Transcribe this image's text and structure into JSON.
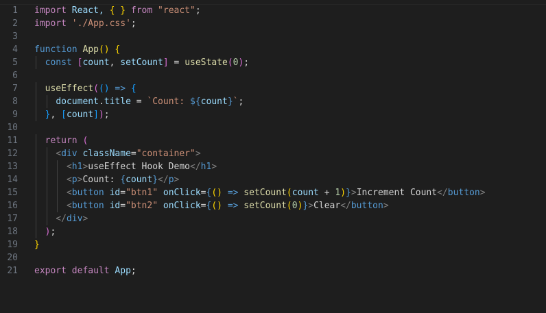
{
  "editor": {
    "line_numbers": [
      "1",
      "2",
      "3",
      "4",
      "5",
      "6",
      "7",
      "8",
      "9",
      "10",
      "11",
      "12",
      "13",
      "14",
      "15",
      "16",
      "17",
      "18",
      "19",
      "20",
      "21"
    ],
    "lines": [
      [
        {
          "t": "import",
          "c": "kw"
        },
        {
          "t": " React, ",
          "c": "var"
        },
        {
          "t": "{ }",
          "c": "br1"
        },
        {
          "t": " ",
          "c": "txt"
        },
        {
          "t": "from",
          "c": "kw"
        },
        {
          "t": " ",
          "c": "txt"
        },
        {
          "t": "\"react\"",
          "c": "str"
        },
        {
          "t": ";",
          "c": "txt"
        }
      ],
      [
        {
          "t": "import",
          "c": "kw"
        },
        {
          "t": " ",
          "c": "txt"
        },
        {
          "t": "'./App.css'",
          "c": "str"
        },
        {
          "t": ";",
          "c": "txt"
        }
      ],
      [],
      [
        {
          "t": "function",
          "c": "kw2"
        },
        {
          "t": " ",
          "c": "txt"
        },
        {
          "t": "App",
          "c": "fn"
        },
        {
          "t": "()",
          "c": "br1"
        },
        {
          "t": " ",
          "c": "txt"
        },
        {
          "t": "{",
          "c": "br1"
        }
      ],
      [
        {
          "t": "  ",
          "c": "txt"
        },
        {
          "t": "const",
          "c": "kw2"
        },
        {
          "t": " ",
          "c": "txt"
        },
        {
          "t": "[",
          "c": "br2"
        },
        {
          "t": "count",
          "c": "var"
        },
        {
          "t": ", ",
          "c": "txt"
        },
        {
          "t": "setCount",
          "c": "var"
        },
        {
          "t": "]",
          "c": "br2"
        },
        {
          "t": " = ",
          "c": "txt"
        },
        {
          "t": "useState",
          "c": "fn"
        },
        {
          "t": "(",
          "c": "br2"
        },
        {
          "t": "0",
          "c": "num"
        },
        {
          "t": ")",
          "c": "br2"
        },
        {
          "t": ";",
          "c": "txt"
        }
      ],
      [],
      [
        {
          "t": "  ",
          "c": "txt"
        },
        {
          "t": "useEffect",
          "c": "fn"
        },
        {
          "t": "(",
          "c": "br2"
        },
        {
          "t": "()",
          "c": "br3"
        },
        {
          "t": " ",
          "c": "txt"
        },
        {
          "t": "=>",
          "c": "kw2"
        },
        {
          "t": " ",
          "c": "txt"
        },
        {
          "t": "{",
          "c": "br3"
        }
      ],
      [
        {
          "t": "    ",
          "c": "txt"
        },
        {
          "t": "document",
          "c": "var"
        },
        {
          "t": ".",
          "c": "txt"
        },
        {
          "t": "title",
          "c": "var"
        },
        {
          "t": " = ",
          "c": "txt"
        },
        {
          "t": "`Count: ",
          "c": "str"
        },
        {
          "t": "${",
          "c": "kw2"
        },
        {
          "t": "count",
          "c": "var"
        },
        {
          "t": "}",
          "c": "kw2"
        },
        {
          "t": "`",
          "c": "str"
        },
        {
          "t": ";",
          "c": "txt"
        }
      ],
      [
        {
          "t": "  ",
          "c": "txt"
        },
        {
          "t": "}",
          "c": "br3"
        },
        {
          "t": ", ",
          "c": "txt"
        },
        {
          "t": "[",
          "c": "br3"
        },
        {
          "t": "count",
          "c": "var"
        },
        {
          "t": "]",
          "c": "br3"
        },
        {
          "t": ")",
          "c": "br2"
        },
        {
          "t": ";",
          "c": "txt"
        }
      ],
      [],
      [
        {
          "t": "  ",
          "c": "txt"
        },
        {
          "t": "return",
          "c": "kw"
        },
        {
          "t": " ",
          "c": "txt"
        },
        {
          "t": "(",
          "c": "br2"
        }
      ],
      [
        {
          "t": "    ",
          "c": "txt"
        },
        {
          "t": "<",
          "c": "pun"
        },
        {
          "t": "div",
          "c": "tag"
        },
        {
          "t": " ",
          "c": "txt"
        },
        {
          "t": "className",
          "c": "attr"
        },
        {
          "t": "=",
          "c": "txt"
        },
        {
          "t": "\"container\"",
          "c": "str"
        },
        {
          "t": ">",
          "c": "pun"
        }
      ],
      [
        {
          "t": "      ",
          "c": "txt"
        },
        {
          "t": "<",
          "c": "pun"
        },
        {
          "t": "h1",
          "c": "tag"
        },
        {
          "t": ">",
          "c": "pun"
        },
        {
          "t": "useEffect Hook Demo",
          "c": "txt"
        },
        {
          "t": "</",
          "c": "pun"
        },
        {
          "t": "h1",
          "c": "tag"
        },
        {
          "t": ">",
          "c": "pun"
        }
      ],
      [
        {
          "t": "      ",
          "c": "txt"
        },
        {
          "t": "<",
          "c": "pun"
        },
        {
          "t": "p",
          "c": "tag"
        },
        {
          "t": ">",
          "c": "pun"
        },
        {
          "t": "Count: ",
          "c": "txt"
        },
        {
          "t": "{",
          "c": "kw2"
        },
        {
          "t": "count",
          "c": "var"
        },
        {
          "t": "}",
          "c": "kw2"
        },
        {
          "t": "</",
          "c": "pun"
        },
        {
          "t": "p",
          "c": "tag"
        },
        {
          "t": ">",
          "c": "pun"
        }
      ],
      [
        {
          "t": "      ",
          "c": "txt"
        },
        {
          "t": "<",
          "c": "pun"
        },
        {
          "t": "button",
          "c": "tag"
        },
        {
          "t": " ",
          "c": "txt"
        },
        {
          "t": "id",
          "c": "attr"
        },
        {
          "t": "=",
          "c": "txt"
        },
        {
          "t": "\"btn1\"",
          "c": "str"
        },
        {
          "t": " ",
          "c": "txt"
        },
        {
          "t": "onClick",
          "c": "attr"
        },
        {
          "t": "=",
          "c": "txt"
        },
        {
          "t": "{",
          "c": "kw2"
        },
        {
          "t": "()",
          "c": "br1"
        },
        {
          "t": " ",
          "c": "txt"
        },
        {
          "t": "=>",
          "c": "kw2"
        },
        {
          "t": " ",
          "c": "txt"
        },
        {
          "t": "setCount",
          "c": "fn"
        },
        {
          "t": "(",
          "c": "br1"
        },
        {
          "t": "count",
          "c": "var"
        },
        {
          "t": " + ",
          "c": "txt"
        },
        {
          "t": "1",
          "c": "num"
        },
        {
          "t": ")",
          "c": "br1"
        },
        {
          "t": "}",
          "c": "kw2"
        },
        {
          "t": ">",
          "c": "pun"
        },
        {
          "t": "Increment Count",
          "c": "txt"
        },
        {
          "t": "</",
          "c": "pun"
        },
        {
          "t": "button",
          "c": "tag"
        },
        {
          "t": ">",
          "c": "pun"
        }
      ],
      [
        {
          "t": "      ",
          "c": "txt"
        },
        {
          "t": "<",
          "c": "pun"
        },
        {
          "t": "button",
          "c": "tag"
        },
        {
          "t": " ",
          "c": "txt"
        },
        {
          "t": "id",
          "c": "attr"
        },
        {
          "t": "=",
          "c": "txt"
        },
        {
          "t": "\"btn2\"",
          "c": "str"
        },
        {
          "t": " ",
          "c": "txt"
        },
        {
          "t": "onClick",
          "c": "attr"
        },
        {
          "t": "=",
          "c": "txt"
        },
        {
          "t": "{",
          "c": "kw2"
        },
        {
          "t": "()",
          "c": "br1"
        },
        {
          "t": " ",
          "c": "txt"
        },
        {
          "t": "=>",
          "c": "kw2"
        },
        {
          "t": " ",
          "c": "txt"
        },
        {
          "t": "setCount",
          "c": "fn"
        },
        {
          "t": "(",
          "c": "br1"
        },
        {
          "t": "0",
          "c": "num"
        },
        {
          "t": ")",
          "c": "br1"
        },
        {
          "t": "}",
          "c": "kw2"
        },
        {
          "t": ">",
          "c": "pun"
        },
        {
          "t": "Clear",
          "c": "txt"
        },
        {
          "t": "</",
          "c": "pun"
        },
        {
          "t": "button",
          "c": "tag"
        },
        {
          "t": ">",
          "c": "pun"
        }
      ],
      [
        {
          "t": "    ",
          "c": "txt"
        },
        {
          "t": "</",
          "c": "pun"
        },
        {
          "t": "div",
          "c": "tag"
        },
        {
          "t": ">",
          "c": "pun"
        }
      ],
      [
        {
          "t": "  ",
          "c": "txt"
        },
        {
          "t": ")",
          "c": "br2"
        },
        {
          "t": ";",
          "c": "txt"
        }
      ],
      [
        {
          "t": "}",
          "c": "br1"
        }
      ],
      [],
      [
        {
          "t": "export",
          "c": "kw"
        },
        {
          "t": " ",
          "c": "txt"
        },
        {
          "t": "default",
          "c": "kw"
        },
        {
          "t": " ",
          "c": "txt"
        },
        {
          "t": "App",
          "c": "var"
        },
        {
          "t": ";",
          "c": "txt"
        }
      ]
    ]
  }
}
